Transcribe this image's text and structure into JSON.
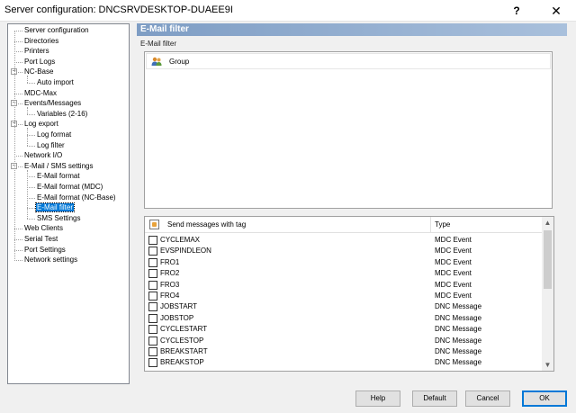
{
  "window": {
    "title": "Server configuration: DNCSRVDESKTOP-DUAEE9I",
    "help_glyph": "?",
    "close_glyph": "✕"
  },
  "tree": {
    "items": [
      {
        "label": "Server configuration",
        "level": 0
      },
      {
        "label": "Directories",
        "level": 0
      },
      {
        "label": "Printers",
        "level": 0
      },
      {
        "label": "Port Logs",
        "level": 0
      },
      {
        "label": "NC-Base",
        "level": 0,
        "expander": "−"
      },
      {
        "label": "Auto import",
        "level": 1
      },
      {
        "label": "MDC-Max",
        "level": 0
      },
      {
        "label": "Events/Messages",
        "level": 0,
        "expander": "−"
      },
      {
        "label": "Variables (2-16)",
        "level": 1
      },
      {
        "label": "Log export",
        "level": 0,
        "expander": "−"
      },
      {
        "label": "Log format",
        "level": 1
      },
      {
        "label": "Log filter",
        "level": 1
      },
      {
        "label": "Network I/O",
        "level": 0
      },
      {
        "label": "E-Mail / SMS settings",
        "level": 0,
        "expander": "−"
      },
      {
        "label": "E-Mail format",
        "level": 1
      },
      {
        "label": "E-Mail format (MDC)",
        "level": 1
      },
      {
        "label": "E-Mail format (NC-Base)",
        "level": 1
      },
      {
        "label": "E-Mail filter",
        "level": 1,
        "selected": true
      },
      {
        "label": "SMS Settings",
        "level": 1
      },
      {
        "label": "Web Clients",
        "level": 0
      },
      {
        "label": "Serial Test",
        "level": 0
      },
      {
        "label": "Port Settings",
        "level": 0
      },
      {
        "label": "Network settings",
        "level": 0
      }
    ]
  },
  "panel": {
    "header": "E-Mail filter",
    "section_label": "E-Mail filter",
    "group_label": "Group"
  },
  "tags": {
    "col_name": "Send messages with tag",
    "col_type": "Type",
    "rows": [
      {
        "name": "CYCLEMAX",
        "type": "MDC Event"
      },
      {
        "name": "EVSPINDLEON",
        "type": "MDC Event"
      },
      {
        "name": "FRO1",
        "type": "MDC Event"
      },
      {
        "name": "FRO2",
        "type": "MDC Event"
      },
      {
        "name": "FRO3",
        "type": "MDC Event"
      },
      {
        "name": "FRO4",
        "type": "MDC Event"
      },
      {
        "name": "JOBSTART",
        "type": "DNC Message"
      },
      {
        "name": "JOBSTOP",
        "type": "DNC Message"
      },
      {
        "name": "CYCLESTART",
        "type": "DNC Message"
      },
      {
        "name": "CYCLESTOP",
        "type": "DNC Message"
      },
      {
        "name": "BREAKSTART",
        "type": "DNC Message"
      },
      {
        "name": "BREAKSTOP",
        "type": "DNC Message"
      }
    ],
    "scroll_up_glyph": "▲",
    "scroll_down_glyph": "▼"
  },
  "buttons": {
    "help": "Help",
    "default": "Default",
    "cancel": "Cancel",
    "ok": "OK"
  },
  "colors": {
    "header_gradient_start": "#7e9dc4",
    "selection": "#0078d7"
  }
}
